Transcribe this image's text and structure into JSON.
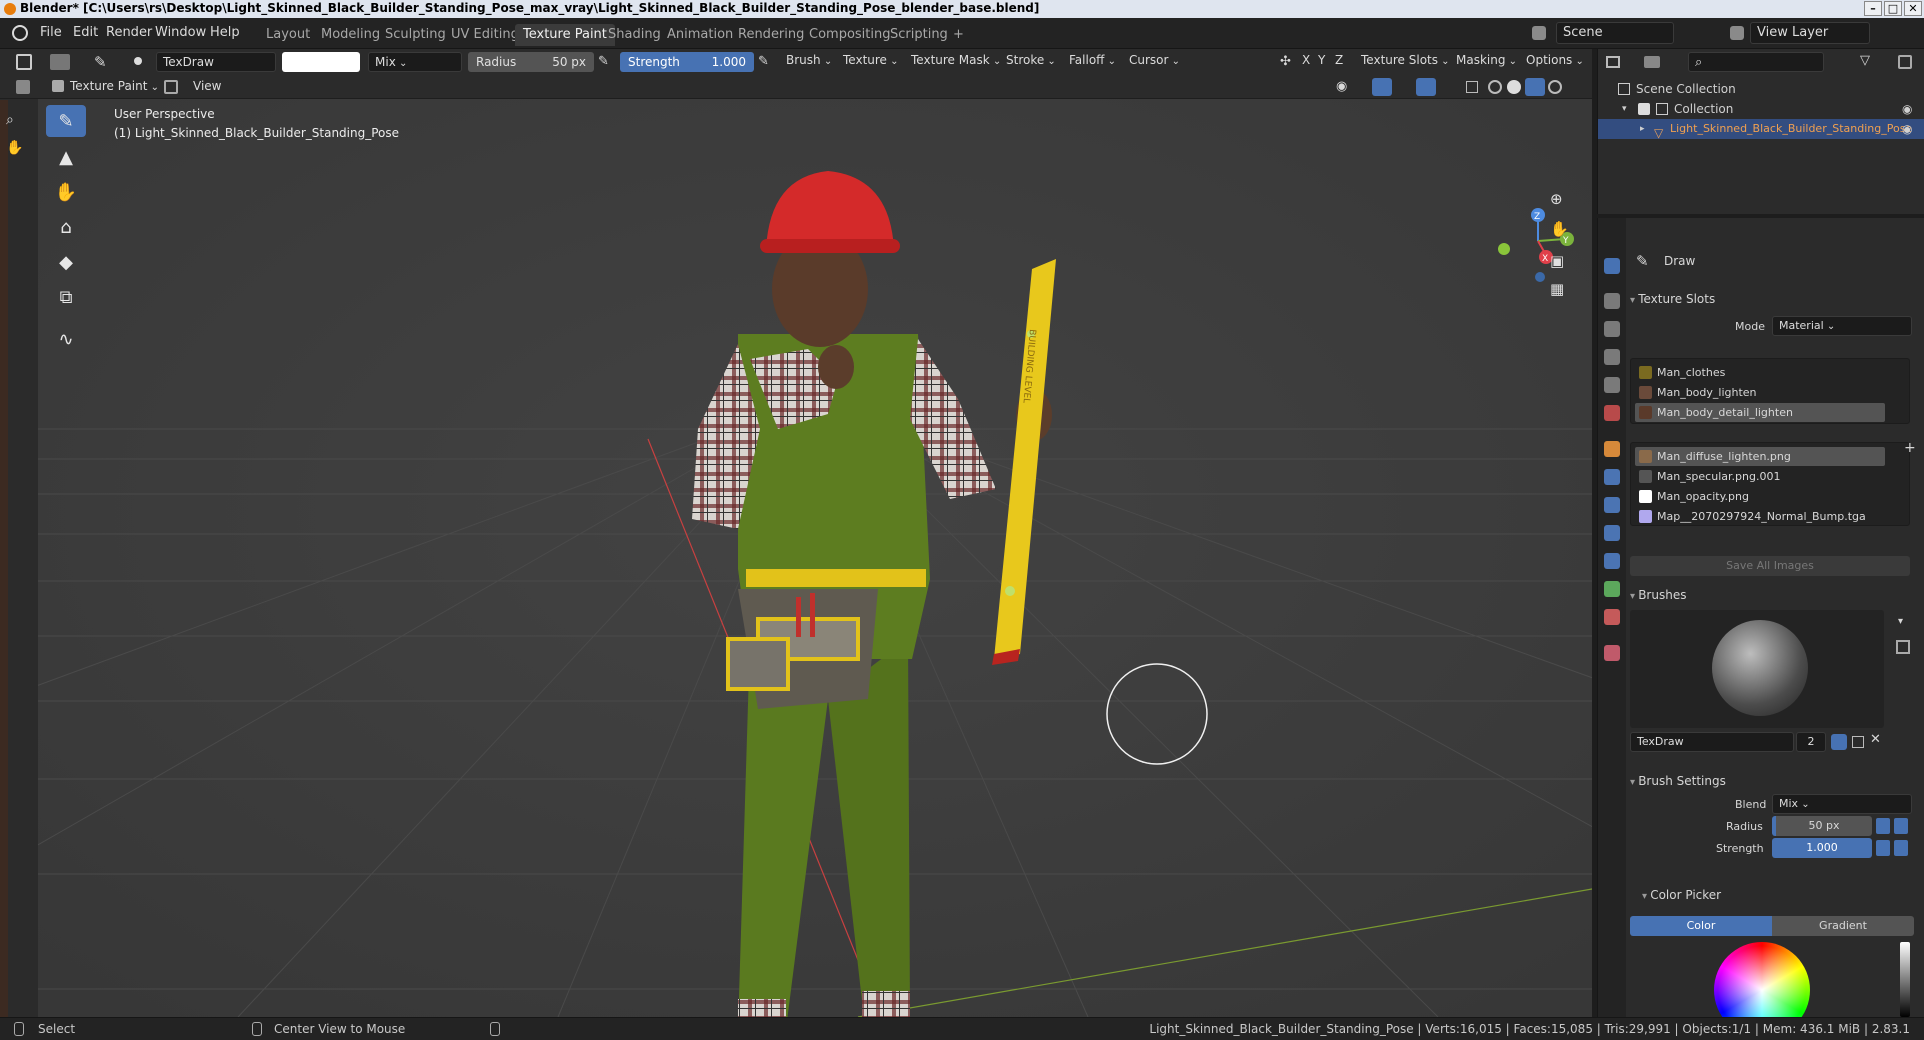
{
  "window": {
    "title": "Blender* [C:\\Users\\rs\\Desktop\\Light_Skinned_Black_Builder_Standing_Pose_max_vray\\Light_Skinned_Black_Builder_Standing_Pose_blender_base.blend]",
    "controls": [
      "–",
      "□",
      "✕"
    ]
  },
  "menu": [
    "File",
    "Edit",
    "Render",
    "Window",
    "Help"
  ],
  "workspaces": [
    "Layout",
    "Modeling",
    "Sculpting",
    "UV Editing",
    "Texture Paint",
    "Shading",
    "Animation",
    "Rendering",
    "Compositing",
    "Scripting",
    "+"
  ],
  "active_workspace": "Texture Paint",
  "scene": {
    "label": "Scene",
    "view_layer": "View Layer"
  },
  "tool_header": {
    "brush_name": "TexDraw",
    "blend": "Mix",
    "radius_label": "Radius",
    "radius_value": "50 px",
    "strength_label": "Strength",
    "strength_value": "1.000",
    "menus": [
      "Brush",
      "Texture",
      "Texture Mask",
      "Stroke",
      "Falloff",
      "Cursor"
    ],
    "axes": [
      "X",
      "Y",
      "Z"
    ],
    "right_menus": [
      "Texture Slots",
      "Masking",
      "Options"
    ]
  },
  "mode_row": {
    "mode": "Texture Paint",
    "view": "View"
  },
  "viewport": {
    "perspective": "User Perspective",
    "object_label": "(1) Light_Skinned_Black_Builder_Standing_Pose",
    "level_text": "BUILDING LEVEL",
    "gizmo_axes": [
      "Z",
      "Y",
      "X"
    ]
  },
  "outliner": {
    "root": "Scene Collection",
    "collection": "Collection",
    "object": "Light_Skinned_Black_Builder_Standing_Pose"
  },
  "properties": {
    "tool_name": "Draw",
    "texture_slots": {
      "title": "Texture Slots",
      "mode_label": "Mode",
      "mode_value": "Material",
      "materials": [
        "Man_clothes",
        "Man_body_lighten",
        "Man_body_detail_lighten"
      ],
      "images": [
        "Man_diffuse_lighten.png",
        "Man_specular.png.001",
        "Man_opacity.png",
        "Map__2070297924_Normal_Bump.tga"
      ],
      "save_all": "Save All Images"
    },
    "brushes": {
      "title": "Brushes",
      "name": "TexDraw",
      "users": "2"
    },
    "brush_settings": {
      "title": "Brush Settings",
      "blend_label": "Blend",
      "blend_value": "Mix",
      "radius_label": "Radius",
      "radius_value": "50 px",
      "strength_label": "Strength",
      "strength_value": "1.000"
    },
    "color_picker": {
      "title": "Color Picker",
      "tab_color": "Color",
      "tab_gradient": "Gradient"
    }
  },
  "statusbar": {
    "select": "Select",
    "center": "Center View to Mouse",
    "stats": "Light_Skinned_Black_Builder_Standing_Pose | Verts:16,015 | Faces:15,085 | Tris:29,991 | Objects:1/1 | Mem: 436.1 MiB | 2.83.1"
  },
  "colors": {
    "accent": "#4772b3",
    "viewport_bg": "#3d3d3d",
    "helmet": "#d42a2a",
    "overall": "#5c7a1e",
    "level": "#e8c81c"
  }
}
